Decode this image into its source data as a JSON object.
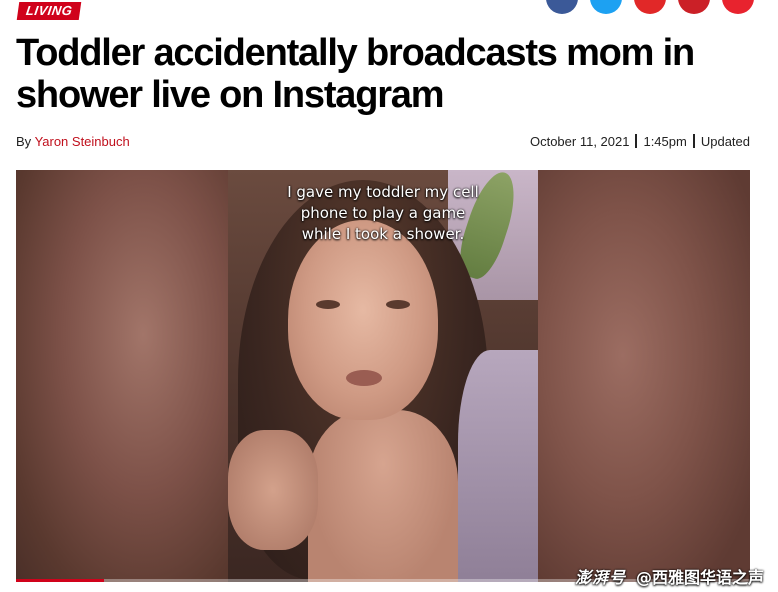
{
  "section": {
    "tag": "LIVING"
  },
  "share": {
    "buttons": [
      {
        "icon": "facebook-icon",
        "color": "#3b5998"
      },
      {
        "icon": "twitter-icon",
        "color": "#1da1f2"
      },
      {
        "icon": "flipboard-icon",
        "color": "#e12828"
      },
      {
        "icon": "pinterest-icon",
        "color": "#cb2027"
      },
      {
        "icon": "reddit-icon",
        "color": "#e8232e"
      }
    ]
  },
  "article": {
    "headline": "Toddler accidentally broadcasts mom in shower live on Instagram",
    "byline_prefix": "By",
    "author": "Yaron Steinbuch",
    "date": "October 11, 2021",
    "time": "1:45pm",
    "updated_label": "Updated"
  },
  "video": {
    "caption_lines": [
      "I gave my toddler my cell",
      "phone to play a game",
      "while I took a shower."
    ],
    "progress_fraction": 0.12
  },
  "watermark": {
    "brand": "澎湃号",
    "account": "@西雅图华语之声"
  },
  "colors": {
    "accent": "#d0021b",
    "author_link": "#c0101d"
  }
}
